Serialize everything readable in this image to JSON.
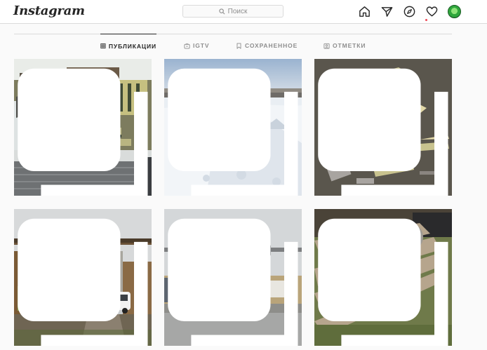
{
  "header": {
    "logo": "Instagram",
    "search_placeholder": "Поиск",
    "nav_icons": [
      "home-icon",
      "direct-icon",
      "explore-icon",
      "activity-icon",
      "profile-avatar"
    ]
  },
  "tabs": [
    {
      "label": "ПУБЛИКАЦИИ",
      "icon": "grid-icon",
      "active": true
    },
    {
      "label": "IGTV",
      "icon": "igtv-icon",
      "active": false
    },
    {
      "label": "СОХРАНЕННОЕ",
      "icon": "bookmark-icon",
      "active": false
    },
    {
      "label": "ОТМЕТКИ",
      "icon": "tagged-icon",
      "active": false
    }
  ],
  "posts": [
    {
      "subject": "aerial view of military vehicle depot in snow",
      "icon": "multiple-photos-icon"
    },
    {
      "subject": "aerial view of snowy field and city skyline",
      "icon": "multiple-photos-icon"
    },
    {
      "subject": "aerial view of scrapped aircraft parts",
      "icon": "multiple-photos-icon"
    },
    {
      "subject": "abandoned industrial gate with white SUV",
      "icon": "multiple-photos-icon"
    },
    {
      "subject": "old aircraft mounted above a roadside cafe",
      "icon": "multiple-photos-icon"
    },
    {
      "subject": "rusty aircraft wreck in grass",
      "icon": "multiple-photos-icon"
    }
  ],
  "colors": {
    "text": "#262626",
    "muted": "#8e8e8e",
    "border": "#dbdbdb",
    "background": "#fafafa",
    "notification": "#ed4956"
  }
}
